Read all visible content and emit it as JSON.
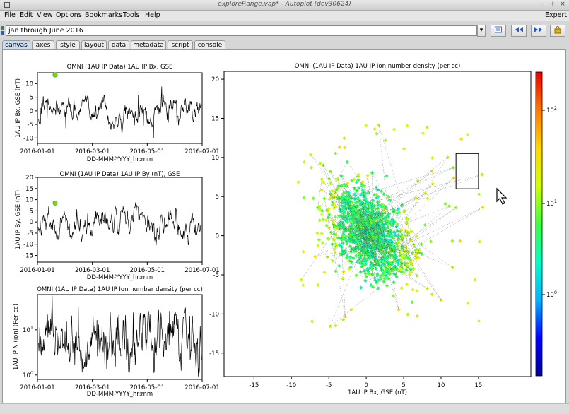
{
  "window": {
    "title": "exploreRange.vap* - Autoplot (dev30624)"
  },
  "menu": [
    "File",
    "Edit",
    "View",
    "Options",
    "Bookmarks",
    "Tools",
    "Help"
  ],
  "menu_right": "Expert",
  "address": {
    "value": "jan through June 2016"
  },
  "tabs": [
    "canvas",
    "axes",
    "style",
    "layout",
    "data",
    "metadata",
    "script",
    "console"
  ],
  "active_tab": "canvas",
  "chart_data": [
    {
      "type": "line",
      "title": "OMNI (1AU IP Data)  1AU IP Bx, GSE",
      "ylabel": "1AU IP Bx, GSE (nT)",
      "xlabel": "DD-MMM-YYYY_hr:mm",
      "xticks": [
        "2016-01-01",
        "2016-03-01",
        "2016-05-01",
        "2016-07-01"
      ],
      "yticks": [
        "-10",
        "-5",
        "0",
        "5",
        "10"
      ],
      "ylim": [
        -12,
        14
      ],
      "highlight_marker_color": "#7cd31a"
    },
    {
      "type": "line",
      "title": "OMNI (1AU IP Data)  1AU IP By (nT), GSE",
      "ylabel": "1AU IP By, GSE (nT)",
      "xlabel": "DD-MMM-YYYY_hr:mm",
      "xticks": [
        "2016-01-01",
        "2016-03-01",
        "2016-05-01",
        "2016-07-01"
      ],
      "yticks": [
        "-15",
        "-10",
        "-5",
        "0",
        "5",
        "10",
        "15",
        "20"
      ],
      "ylim": [
        -18,
        20
      ],
      "highlight_marker_color": "#7cd31a"
    },
    {
      "type": "line",
      "title": "OMNI (1AU IP Data)  1AU IP Ion number density (per cc)",
      "ylabel": "1AU IP N (ion) (Per cc)",
      "xlabel": "DD-MMM-YYYY_hr:mm",
      "xticks": [
        "2016-01-01",
        "2016-03-01",
        "2016-05-01",
        "2016-07-01"
      ],
      "yticks": [
        "10^0",
        "10^1"
      ],
      "ylog": true,
      "ylim": [
        0.8,
        60
      ]
    },
    {
      "type": "scatter",
      "title": "OMNI (1AU IP Data)  1AU IP Ion number density (per cc)",
      "xlabel": "1AU IP Bx, GSE (nT)",
      "ylabel": "",
      "xlim": [
        -19,
        22
      ],
      "ylim": [
        -18,
        21
      ],
      "xticks": [
        "-15",
        "-10",
        "-5",
        "0",
        "5",
        "10",
        "15"
      ],
      "yticks": [
        "-15",
        "-10",
        "-5",
        "0",
        "5",
        "10",
        "15",
        "20"
      ],
      "colorbar": {
        "ticks": [
          "10^0",
          "10^1",
          "10^2"
        ],
        "scale": "log",
        "colors": [
          "#00008b",
          "#0000ff",
          "#00b4ff",
          "#00ffc8",
          "#3cff3c",
          "#d2ff00",
          "#ffd700",
          "#ff7800",
          "#e60000"
        ]
      },
      "selection_box": {
        "x": [
          12,
          15
        ],
        "y": [
          6,
          10.5
        ]
      },
      "annotation": "points connected by dotted lines; main cluster centred near Bx=0, By=0"
    }
  ]
}
